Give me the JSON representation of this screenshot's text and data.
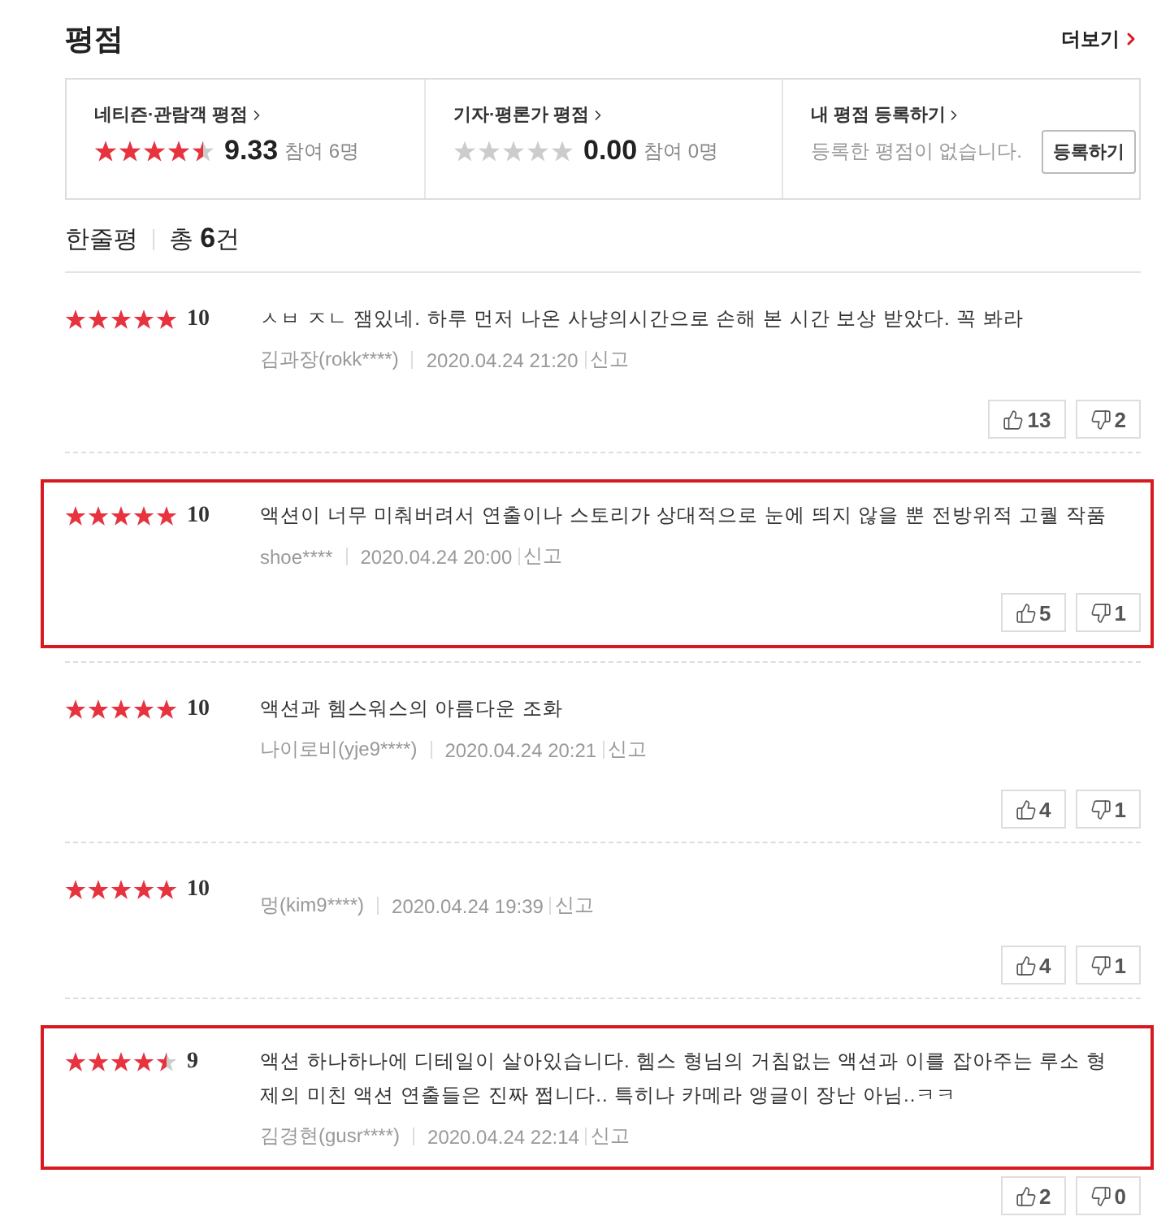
{
  "section": {
    "title": "평점",
    "more_link": "더보기"
  },
  "summary": [
    {
      "kind": "score",
      "label": "네티즌·관람객 평점",
      "stars": 4.5,
      "score": "9.33",
      "participants": "참여 6명"
    },
    {
      "kind": "score",
      "label": "기자·평론가 평점",
      "stars": 0,
      "score": "0.00",
      "participants": "참여 0명"
    },
    {
      "kind": "register",
      "label": "내 평점 등록하기",
      "message": "등록한 평점이 없습니다.",
      "button": "등록하기"
    }
  ],
  "comments_header": {
    "title": "한줄평",
    "total": "총 **6**건"
  },
  "reviews": [
    {
      "stars": 5,
      "score": "10",
      "text": "ㅅㅂ ㅈㄴ 잼있네. 하루 먼저 나온 사냥의시간으로 손해 본 시간 보상 받았다. 꼭 봐라",
      "author": "김과장(rokk****)",
      "date": "2020.04.24 21:20",
      "report": "신고",
      "likes": "13",
      "dislikes": "2",
      "highlighted": false
    },
    {
      "stars": 5,
      "score": "10",
      "text": "액션이 너무 미춰버려서 연출이나 스토리가 상대적으로 눈에 띄지 않을 뿐 전방위적 고퀄 작품",
      "author": "shoe****",
      "date": "2020.04.24 20:00",
      "report": "신고",
      "likes": "5",
      "dislikes": "1",
      "highlighted": true,
      "highlight_includes_votes": true
    },
    {
      "stars": 5,
      "score": "10",
      "text": "액션과 헴스워스의 아름다운 조화",
      "author": "나이로비(yje9****)",
      "date": "2020.04.24 20:21",
      "report": "신고",
      "likes": "4",
      "dislikes": "1",
      "highlighted": false
    },
    {
      "stars": 5,
      "score": "10",
      "author": "멍(kim9****)",
      "date": "2020.04.24 19:39",
      "report": "신고",
      "likes": "4",
      "dislikes": "1",
      "highlighted": false
    },
    {
      "stars": 4.5,
      "score": "9",
      "text": "액션 하나하나에 디테일이 살아있습니다. 헴스 형님의 거침없는 액션과 이를 잡아주는 루소 형제의 미친 액션 연출들은 진짜 쩝니다.. 특히나 카메라 앵글이 장난 아님..ㅋㅋ",
      "author": "김경현(gusr****)",
      "date": "2020.04.24 22:14",
      "report": "신고",
      "likes": "2",
      "dislikes": "0",
      "highlighted": true,
      "highlight_includes_votes": false
    }
  ]
}
